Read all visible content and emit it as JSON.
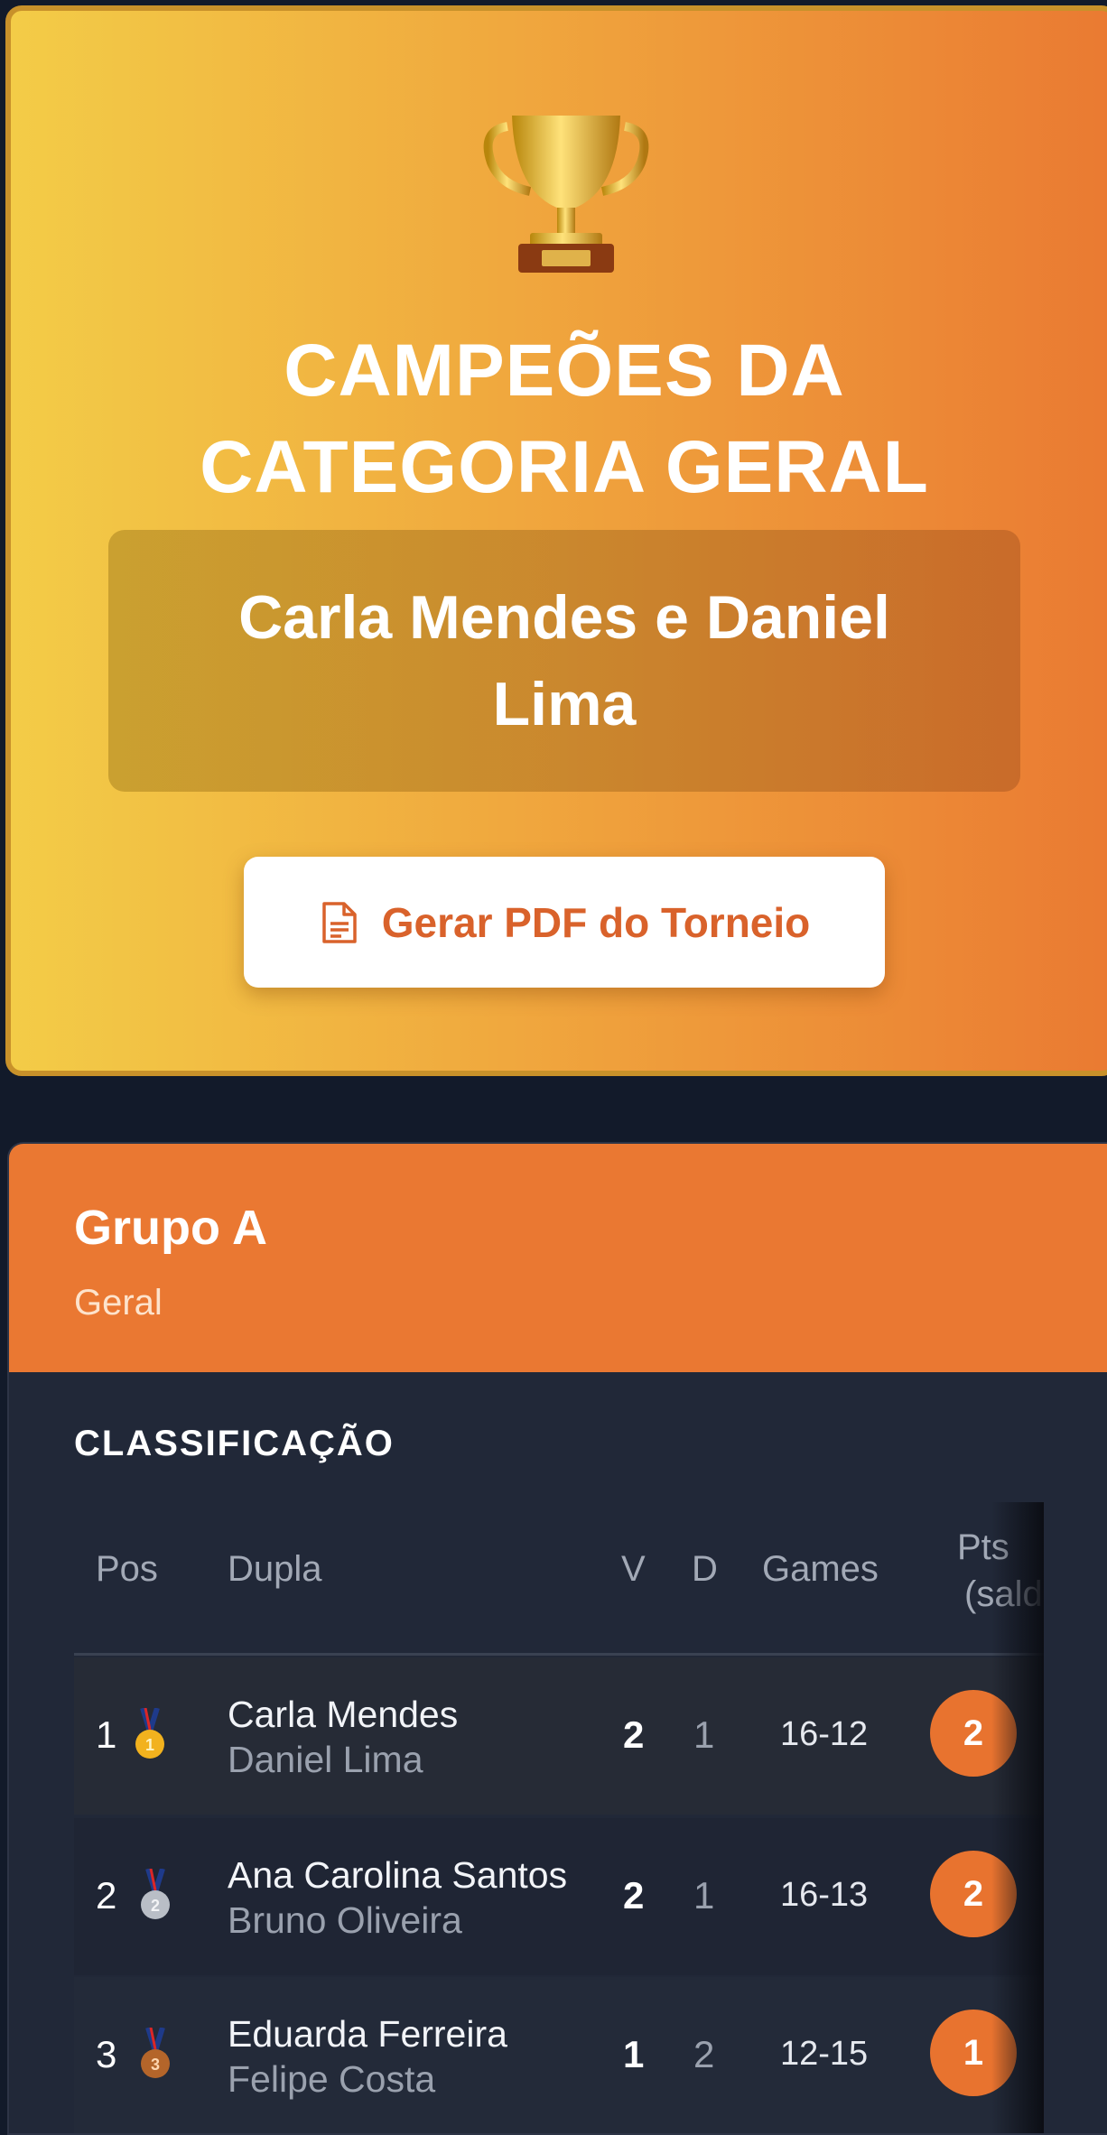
{
  "champion_card": {
    "trophy_icon": "trophy-icon",
    "title_line1": "CAMPEÕES DA",
    "title_line2": "CATEGORIA GERAL",
    "winner": "Carla Mendes e Daniel Lima",
    "pdf_button": {
      "icon": "document-icon",
      "label": "Gerar PDF do Torneio"
    }
  },
  "group": {
    "title": "Grupo A",
    "subtitle": "Geral",
    "section_title": "CLASSIFICAÇÃO",
    "columns": {
      "pos": "Pos",
      "pair": "Dupla",
      "wins": "V",
      "losses": "D",
      "games": "Games",
      "pts_line1": "Pts",
      "pts_line2": "(saldo)"
    },
    "rows": [
      {
        "pos": "1",
        "medal": "gold-medal-icon",
        "player1": "Carla Mendes",
        "player2": "Daniel Lima",
        "wins": "2",
        "losses": "1",
        "games": "16-12",
        "pts": "2"
      },
      {
        "pos": "2",
        "medal": "silver-medal-icon",
        "player1": "Ana Carolina Santos",
        "player2": "Bruno Oliveira",
        "wins": "2",
        "losses": "1",
        "games": "16-13",
        "pts": "2"
      },
      {
        "pos": "3",
        "medal": "bronze-medal-icon",
        "player1": "Eduarda Ferreira",
        "player2": "Felipe Costa",
        "wins": "1",
        "losses": "2",
        "games": "12-15",
        "pts": "1"
      }
    ]
  },
  "colors": {
    "accent": "#ea7832",
    "background": "#121a2a",
    "card": "#212838"
  }
}
